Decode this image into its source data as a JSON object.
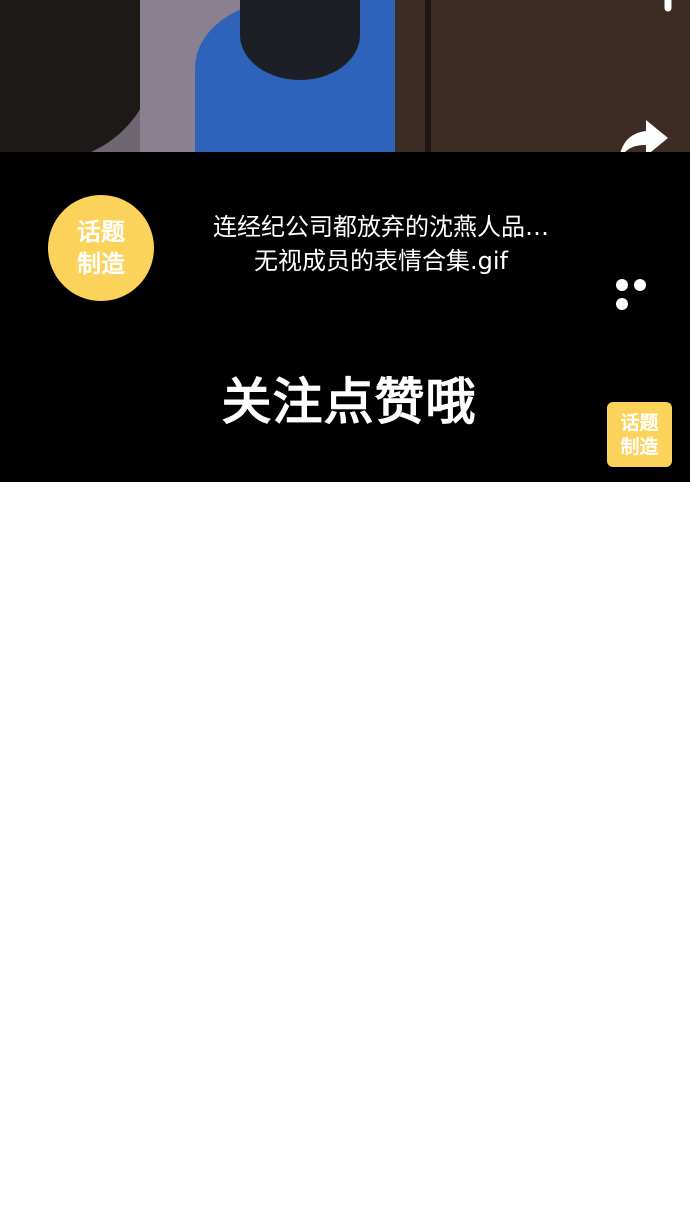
{
  "video": {
    "icons": [
      "reply-icon",
      "share-icon"
    ]
  },
  "topic": {
    "badge_line1": "话题",
    "badge_line2": "制造",
    "title_line1": "连经纪公司都放弃的沈燕人品…",
    "title_line2": "无视成员的表情合集.gif",
    "more_icon": "more-dots-icon"
  },
  "cta": {
    "text": "关注点赞哦"
  },
  "watermark": {
    "line1": "话题",
    "line2": "制造"
  },
  "colors": {
    "badge": "#fbd25a",
    "panel": "#000000",
    "jacket": "#2f63b9"
  }
}
